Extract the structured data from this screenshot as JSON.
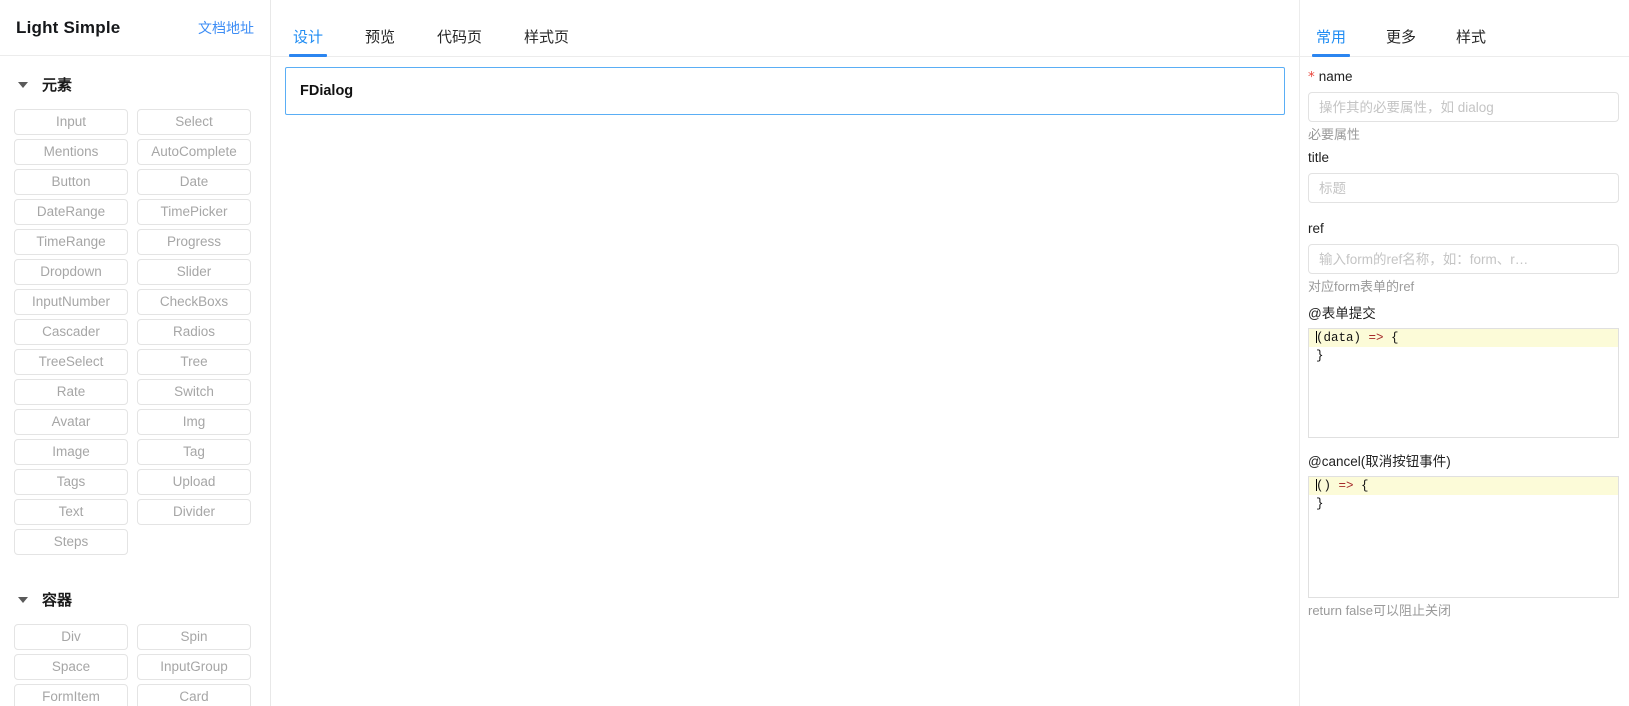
{
  "sidebar": {
    "brand_title": "Light Simple",
    "doc_link": "文档地址",
    "groups": [
      {
        "title": "元素",
        "caret": "caret-down-icon",
        "items": [
          "Input",
          "Select",
          "Mentions",
          "AutoComplete",
          "Button",
          "Date",
          "DateRange",
          "TimePicker",
          "TimeRange",
          "Progress",
          "Dropdown",
          "Slider",
          "InputNumber",
          "CheckBoxs",
          "Cascader",
          "Radios",
          "TreeSelect",
          "Tree",
          "Rate",
          "Switch",
          "Avatar",
          "Img",
          "Image",
          "Tag",
          "Tags",
          "Upload",
          "Text",
          "Divider",
          "Steps"
        ]
      },
      {
        "title": "容器",
        "caret": "caret-down-icon",
        "items": [
          "Div",
          "Spin",
          "Space",
          "InputGroup",
          "FormItem",
          "Card"
        ]
      }
    ]
  },
  "center": {
    "tabs": [
      {
        "label": "设计",
        "active": true
      },
      {
        "label": "预览",
        "active": false
      },
      {
        "label": "代码页",
        "active": false
      },
      {
        "label": "样式页",
        "active": false
      }
    ],
    "canvas": {
      "selected_node_label": "FDialog"
    }
  },
  "right_panel": {
    "tabs": [
      {
        "label": "常用",
        "active": true
      },
      {
        "label": "更多",
        "active": false
      },
      {
        "label": "样式",
        "active": false
      }
    ],
    "fields": {
      "name": {
        "required_marker": "*",
        "label": "name",
        "value": "",
        "placeholder": "操作其的必要属性，如 dialog",
        "help": "必要属性"
      },
      "title": {
        "label": "title",
        "value": "",
        "placeholder": "标题"
      },
      "ref": {
        "label": "ref",
        "value": "",
        "placeholder": "输入form的ref名称，如：form、r…",
        "help": "对应form表单的ref"
      },
      "submit_event": {
        "label": "@表单提交",
        "code_line1": "(data) => {",
        "code_line2": "",
        "code_line3": "}"
      },
      "cancel_event": {
        "label": "@cancel(取消按钮事件)",
        "code_line1": "() => {",
        "code_line2": "",
        "code_line3": "}",
        "help": "return false可以阻止关闭"
      }
    }
  },
  "colors": {
    "accent": "#2b85f0",
    "link": "#3d8df5",
    "required": "#e8443a",
    "node_border": "#5aaef5",
    "code_highlight": "#fcfbd8",
    "muted_text": "#9a9a9a",
    "palette_text": "#a6a6a6"
  }
}
